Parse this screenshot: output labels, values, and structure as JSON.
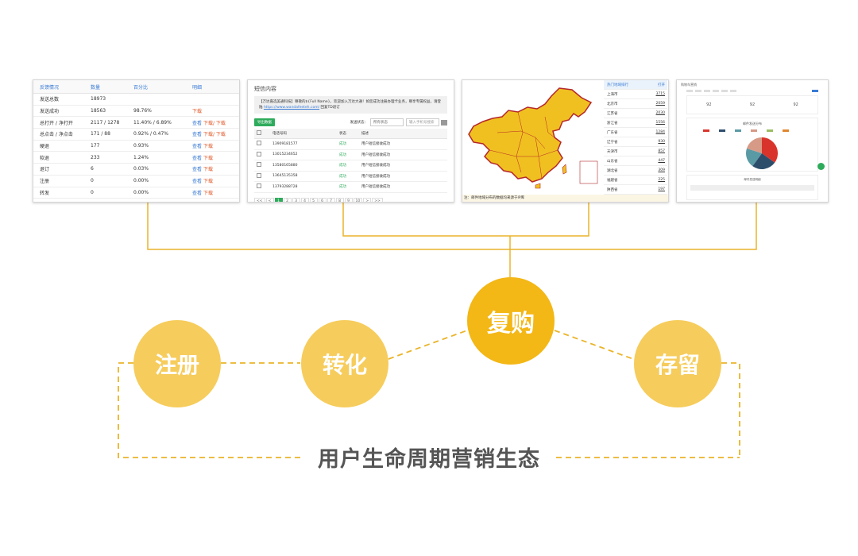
{
  "panel1": {
    "headers": [
      "反馈情况",
      "数量",
      "百分比",
      "明细"
    ],
    "rows": [
      {
        "label": "发送总数",
        "count": "18973",
        "pct": "",
        "view": "",
        "download": ""
      },
      {
        "label": "发送成功",
        "count": "18563",
        "pct": "98.76%",
        "view": "",
        "download": "下载"
      },
      {
        "label": "总打开 / 净打开",
        "count": "2117 / 1278",
        "pct": "11.40% / 6.89%",
        "view": "查看",
        "download": "下载/ 下载"
      },
      {
        "label": "总点击 / 净点击",
        "count": "171 / 88",
        "pct": "0.92% / 0.47%",
        "view": "查看",
        "download": "下载/ 下载"
      },
      {
        "label": "硬退",
        "count": "177",
        "pct": "0.93%",
        "view": "查看",
        "download": "下载"
      },
      {
        "label": "软退",
        "count": "233",
        "pct": "1.24%",
        "view": "查看",
        "download": "下载"
      },
      {
        "label": "退订",
        "count": "6",
        "pct": "0.03%",
        "view": "查看",
        "download": "下载"
      },
      {
        "label": "注册",
        "count": "0",
        "pct": "0.00%",
        "view": "查看",
        "download": "下载"
      },
      {
        "label": "转发",
        "count": "0",
        "pct": "0.00%",
        "view": "查看",
        "download": "下载"
      }
    ]
  },
  "panel2": {
    "title": "短信内容",
    "notice_text": "【万达嘉选美通科技】尊敬的${Full Name}，欢迎加入万达大通！如您成功注册办理卡业务，尊享专属权益，请登陆",
    "notice_link": "https://www.wandafeeteh.com/",
    "notice_tail": "回复TD退订",
    "export_btn": "导出数据",
    "status_label": "发送状态：",
    "status_select": "所有状态",
    "search_placeholder": "输入手机号搜索",
    "columns": [
      "",
      "电话号码",
      "状态",
      "描述"
    ],
    "rows": [
      {
        "phone": "13909181577",
        "status": "成功",
        "desc": "用户短信接收成功"
      },
      {
        "phone": "13015234652",
        "status": "成功",
        "desc": "用户短信接收成功"
      },
      {
        "phone": "13580165880",
        "status": "成功",
        "desc": "用户短信接收成功"
      },
      {
        "phone": "13645135358",
        "status": "成功",
        "desc": "用户短信接收成功"
      },
      {
        "phone": "13793288728",
        "status": "成功",
        "desc": "用户短信接收成功"
      }
    ],
    "pager": [
      "<<",
      "<",
      "1",
      "2",
      "3",
      "4",
      "5",
      "6",
      "7",
      "8",
      "9",
      "10",
      ">",
      ">>"
    ],
    "current_page": "1"
  },
  "panel3": {
    "sidebar_header": "热门地域排行",
    "sidebar_header_value": "打开",
    "regions": [
      {
        "name": "上海市",
        "value": "3715"
      },
      {
        "name": "北京市",
        "value": "2059"
      },
      {
        "name": "江苏省",
        "value": "2030"
      },
      {
        "name": "浙江省",
        "value": "1556"
      },
      {
        "name": "广东省",
        "value": "1284"
      },
      {
        "name": "辽宁省",
        "value": "930"
      },
      {
        "name": "天津市",
        "value": "857"
      },
      {
        "name": "山东省",
        "value": "447"
      },
      {
        "name": "湖北省",
        "value": "309"
      },
      {
        "name": "福建省",
        "value": "225"
      },
      {
        "name": "陕西省",
        "value": "197"
      }
    ],
    "footer_note": "注：邮件地域分布的数据均来源于IP库",
    "map_fill": "#f0c020",
    "map_stroke": "#b5262a"
  },
  "panel4": {
    "title": "购物车营销",
    "stats": [
      "92",
      "92",
      "92"
    ],
    "chart_title": "邮件发送分布",
    "table_title": "邮件发送明细"
  },
  "stages": {
    "register": "注册",
    "convert": "转化",
    "repurchase": "复购",
    "retain": "存留"
  },
  "ecosystem_label": "用户生命周期营销生态",
  "colors": {
    "stage_light": "#f6cc5c",
    "stage_dark": "#f3b716",
    "connector": "#eab42a",
    "dashed": "#eab42a"
  },
  "pie": {
    "slices": [
      {
        "value": 35,
        "color": "#d9342b"
      },
      {
        "value": 25,
        "color": "#2d4e6b"
      },
      {
        "value": 20,
        "color": "#5a9aa5"
      },
      {
        "value": 20,
        "color": "#d79a86"
      }
    ],
    "legend_colors": [
      "#d9342b",
      "#2d4e6b",
      "#5a9aa5",
      "#d79a86",
      "#9bbd63",
      "#e0862f"
    ]
  }
}
